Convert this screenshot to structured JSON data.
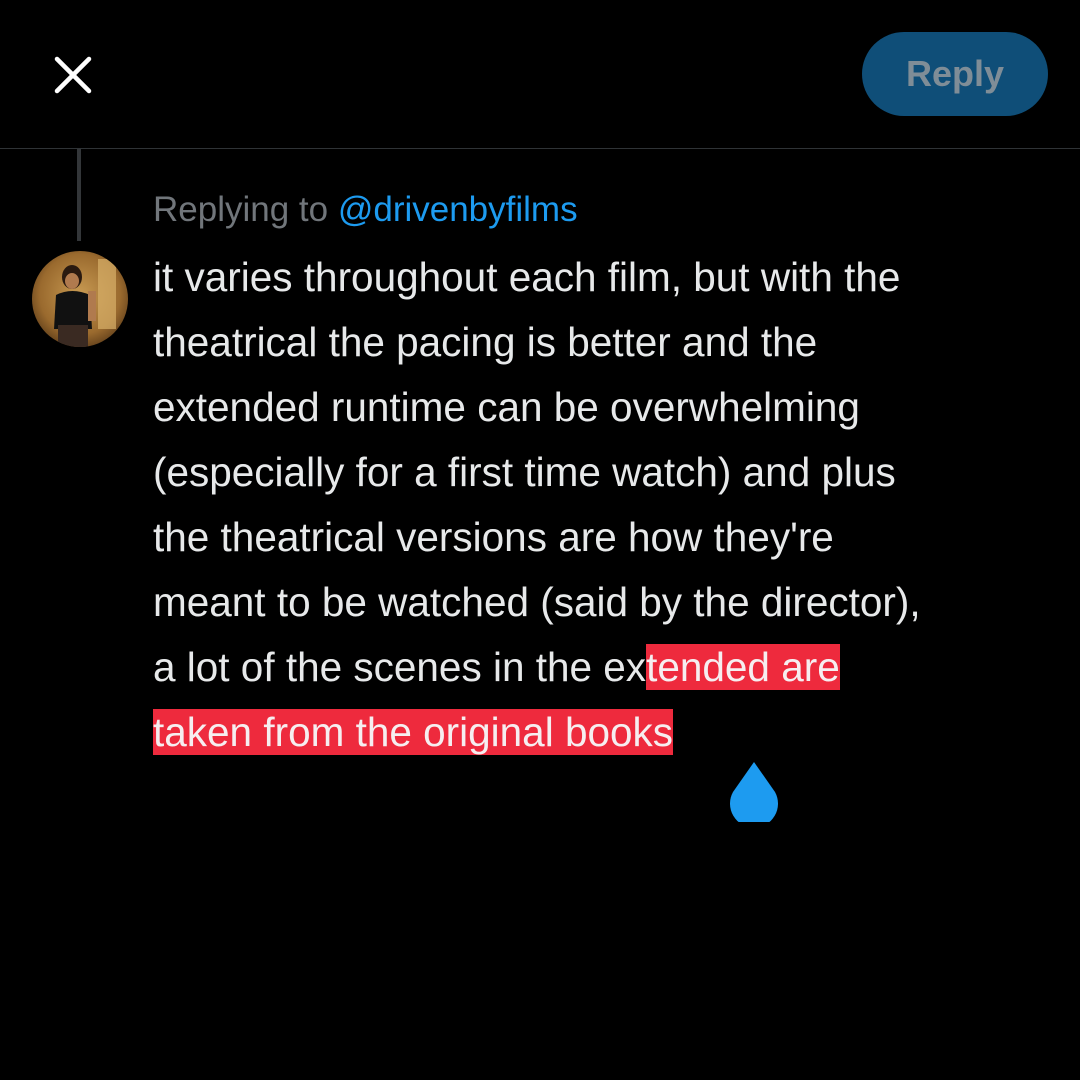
{
  "header": {
    "close_icon": "close-icon",
    "reply_label": "Reply"
  },
  "composer_context": {
    "replying_prefix": "Replying to ",
    "mention": "@drivenbyfilms"
  },
  "tweet": {
    "text_before_selection": "it varies throughout each film, but with the\ntheatrical the pacing is better and the\nextended runtime can be overwhelming\n(especially for a first time watch) and plus\nthe theatrical versions are how they're\nmeant to be watched (said by the director),\na lot of the scenes in the ex",
    "selected_text": "tended are\ntaken from the original books"
  },
  "selection_handle": {
    "icon": "drop-handle-icon"
  },
  "colors": {
    "background": "#000000",
    "text": "#e7e9ea",
    "muted": "#71767b",
    "accent": "#1d9bf0",
    "reply_button_bg": "#0f4e78",
    "reply_button_text": "#7f8d97",
    "selection": "#ee2a3d"
  }
}
